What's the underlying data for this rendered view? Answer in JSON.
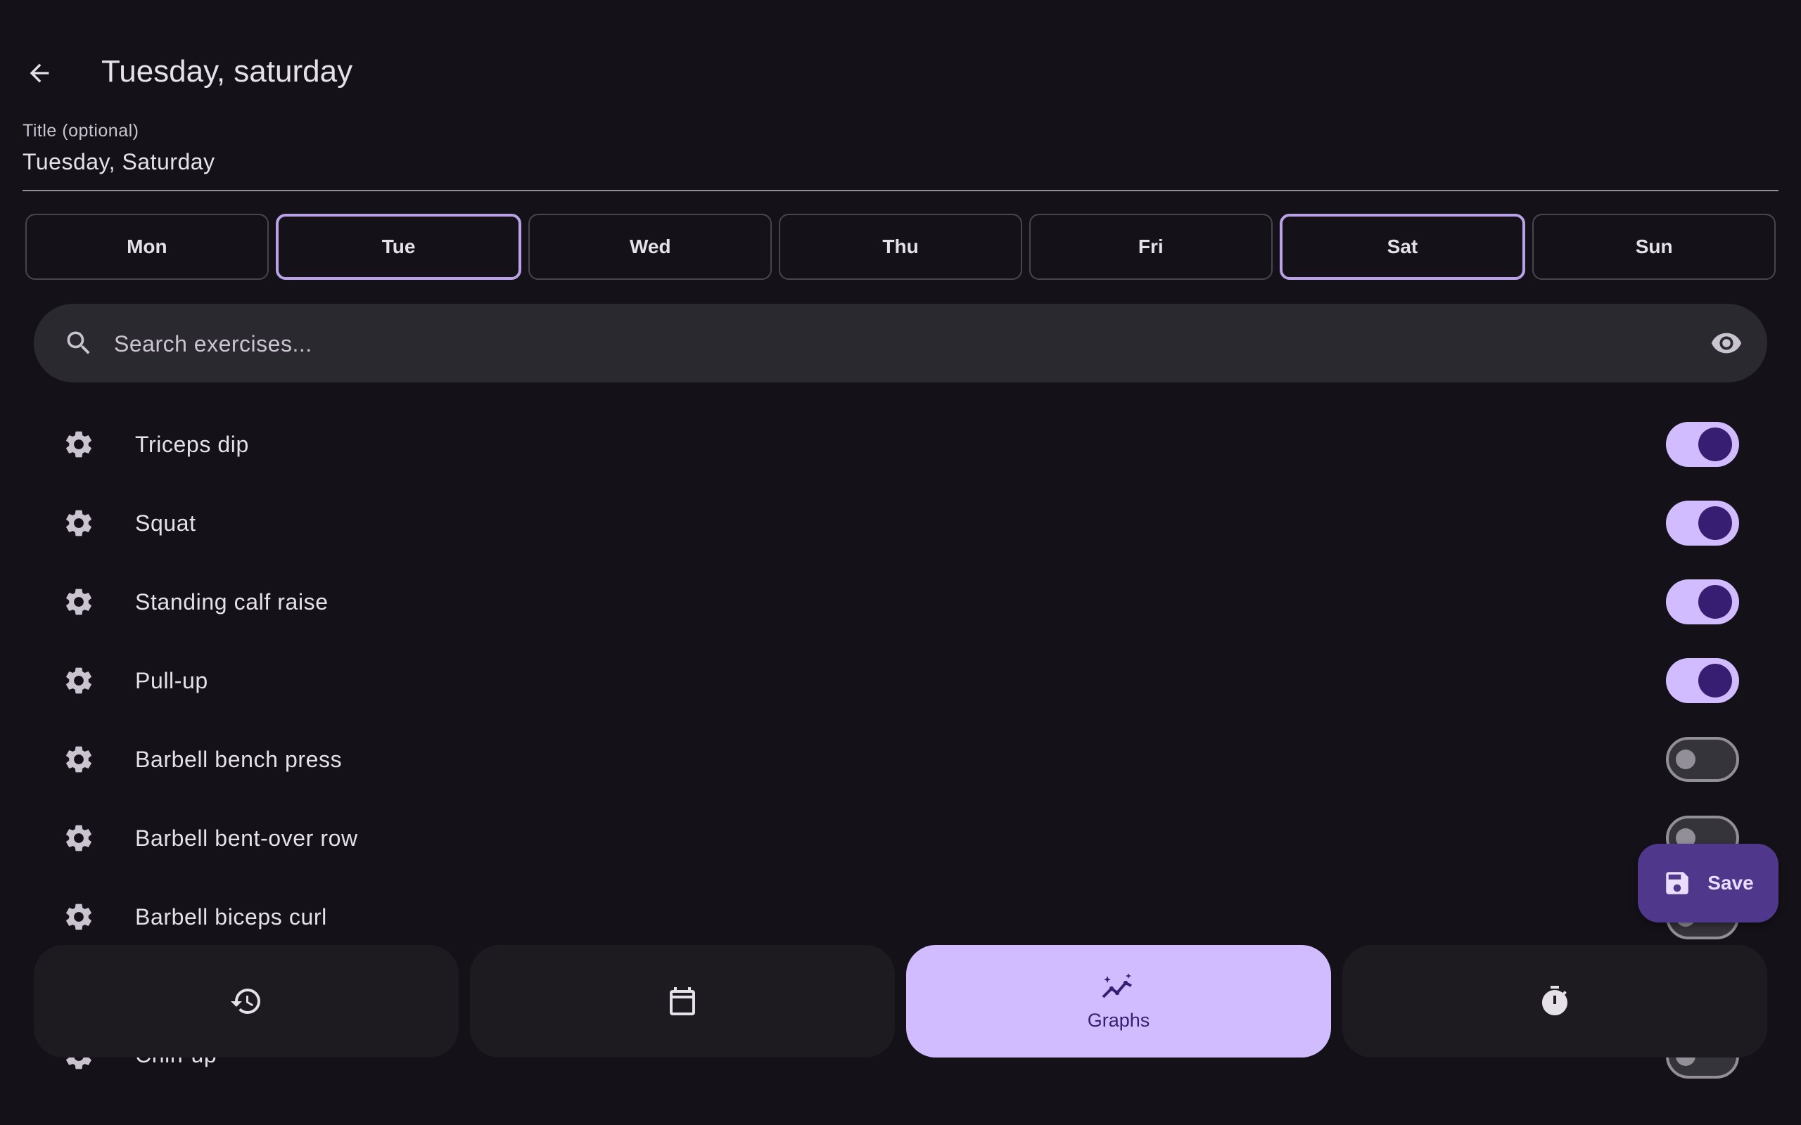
{
  "header": {
    "title": "Tuesday, saturday"
  },
  "title_field": {
    "label": "Title (optional)",
    "value": "Tuesday, Saturday"
  },
  "days": [
    {
      "label": "Mon",
      "selected": false
    },
    {
      "label": "Tue",
      "selected": true
    },
    {
      "label": "Wed",
      "selected": false
    },
    {
      "label": "Thu",
      "selected": false
    },
    {
      "label": "Fri",
      "selected": false
    },
    {
      "label": "Sat",
      "selected": true
    },
    {
      "label": "Sun",
      "selected": false
    }
  ],
  "search": {
    "placeholder": "Search exercises...",
    "icon": "search-icon",
    "visibility_icon": "eye-icon"
  },
  "exercises": [
    {
      "name": "Triceps dip",
      "enabled": true
    },
    {
      "name": "Squat",
      "enabled": true
    },
    {
      "name": "Standing calf raise",
      "enabled": true
    },
    {
      "name": "Pull-up",
      "enabled": true
    },
    {
      "name": "Barbell bench press",
      "enabled": false
    },
    {
      "name": "Barbell bent-over row",
      "enabled": false
    },
    {
      "name": "Barbell biceps curl",
      "enabled": false
    },
    {
      "name": "Chin-up",
      "enabled": false
    }
  ],
  "fab": {
    "label": "Save",
    "icon": "save-icon"
  },
  "bottom_nav": [
    {
      "icon": "history-icon",
      "label": "",
      "active": false
    },
    {
      "icon": "calendar-icon",
      "label": "",
      "active": false
    },
    {
      "icon": "graphs-icon",
      "label": "Graphs",
      "active": true
    },
    {
      "icon": "timer-icon",
      "label": "",
      "active": false
    }
  ],
  "colors": {
    "background": "#141218",
    "primary": "#d0bcff",
    "on_primary": "#381e72",
    "fab": "#4f378b",
    "surface_variant": "#2b2930"
  }
}
